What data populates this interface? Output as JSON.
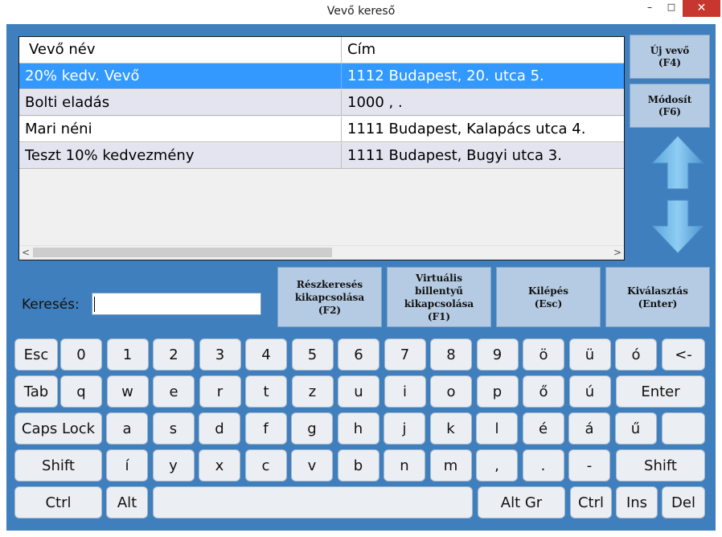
{
  "window": {
    "title": "Vevő kereső",
    "minimize": "–",
    "maximize": "□",
    "close": "✕"
  },
  "table": {
    "headers": [
      "Vevő név",
      "Cím"
    ],
    "rows": [
      [
        "20% kedv. Vevő",
        "1112 Budapest, 20. utca 5."
      ],
      [
        "Bolti eladás",
        "1000 , ."
      ],
      [
        "Mari néni",
        "1111 Budapest, Kalapács utca 4."
      ],
      [
        "Teszt 10% kedvezmény",
        "1111 Budapest, Bugyi utca 3."
      ]
    ],
    "selected_row": 0,
    "scroll_left": "<",
    "scroll_right": ">"
  },
  "side": {
    "new_customer": "Új vevő\n(F4)",
    "modify": "Módosít\n(F6)",
    "up_icon": "arrow-up-icon",
    "down_icon": "arrow-down-icon"
  },
  "search": {
    "label": "Keresés:",
    "value": ""
  },
  "actions": {
    "partial_search": "Részkeresés\nkikapcsolása\n(F2)",
    "virtual_keyboard": "Virtuális billentyű\nkikapcsolása\n(F1)",
    "exit": "Kilépés\n(Esc)",
    "select": "Kiválasztás\n(Enter)"
  },
  "keyboard": {
    "rows": [
      [
        "Esc",
        "0",
        "1",
        "2",
        "3",
        "4",
        "5",
        "6",
        "7",
        "8",
        "9",
        "ö",
        "ü",
        "ó",
        "<-"
      ],
      [
        "Tab",
        "q",
        "w",
        "e",
        "r",
        "t",
        "z",
        "u",
        "i",
        "o",
        "p",
        "ő",
        "ú",
        "Enter"
      ],
      [
        "Caps Lock",
        "a",
        "s",
        "d",
        "f",
        "g",
        "h",
        "j",
        "k",
        "l",
        "é",
        "á",
        "ű",
        ""
      ],
      [
        "Shift",
        "í",
        "y",
        "x",
        "c",
        "v",
        "b",
        "n",
        "m",
        ",",
        ".",
        "-",
        "Shift"
      ],
      [
        "Ctrl",
        "Alt",
        "",
        "Alt Gr",
        "Ctrl",
        "Ins",
        "Del"
      ]
    ]
  },
  "colors": {
    "frame": "#3f7fbd",
    "selection": "#3399ff",
    "button": "#b5cbe3",
    "key": "#ebeef3"
  }
}
